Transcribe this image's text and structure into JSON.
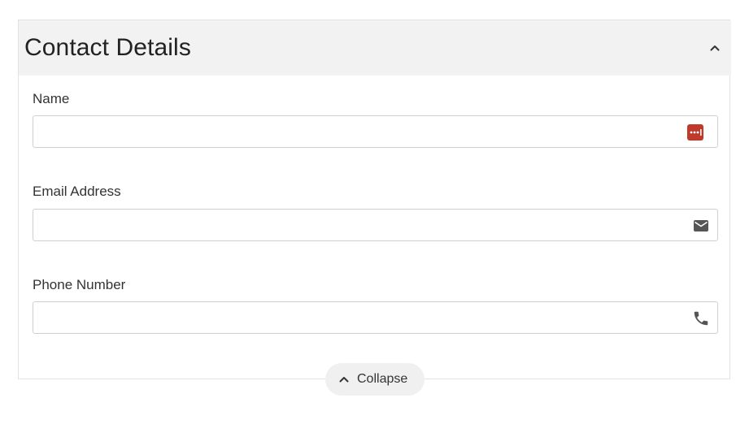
{
  "section": {
    "title": "Contact Details"
  },
  "fields": {
    "name": {
      "label": "Name",
      "value": "",
      "placeholder": "",
      "icon": "password-manager-icon"
    },
    "email": {
      "label": "Email Address",
      "value": "",
      "placeholder": "",
      "icon": "envelope-icon"
    },
    "phone": {
      "label": "Phone Number",
      "value": "",
      "placeholder": "",
      "icon": "phone-icon"
    }
  },
  "footer": {
    "collapse_label": "Collapse"
  },
  "colors": {
    "header_bg": "#f2f2f2",
    "password_manager_icon": "#c0392b",
    "icon_gray": "#555555",
    "pill_bg": "#f0f0f0"
  }
}
